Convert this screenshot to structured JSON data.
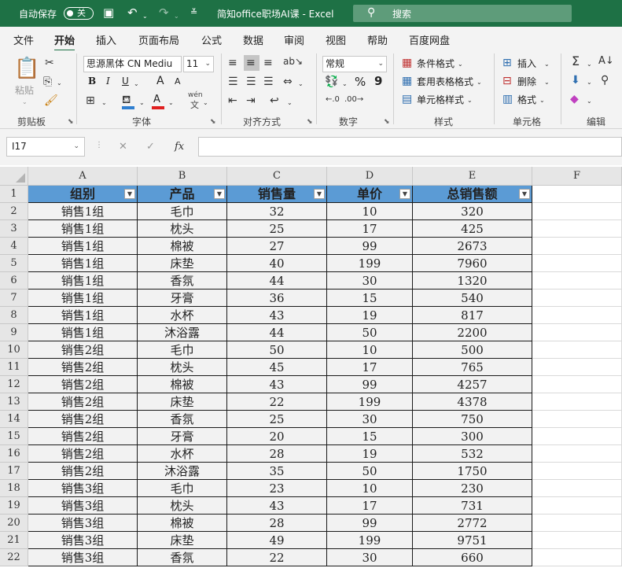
{
  "titlebar": {
    "autosave": "自动保存",
    "toggle": "关",
    "title": "简知office职场AI课  -  Excel",
    "search_placeholder": "搜索",
    "icons": [
      "save-icon",
      "undo-icon",
      "redo-icon",
      "customize-icon",
      "search-icon"
    ]
  },
  "menu": {
    "tabs": [
      "文件",
      "开始",
      "插入",
      "页面布局",
      "公式",
      "数据",
      "审阅",
      "视图",
      "帮助",
      "百度网盘"
    ],
    "active": "开始"
  },
  "ribbon": {
    "clipboard": {
      "paste": "粘贴",
      "group": "剪贴板"
    },
    "font": {
      "name": "思源黑体 CN Mediu",
      "size": "11",
      "bold": "B",
      "italic": "I",
      "underline": "U",
      "grow": "A",
      "shrink": "A",
      "wen": "wén",
      "wen_char": "文",
      "group": "字体"
    },
    "alignment": {
      "group": "对齐方式"
    },
    "number": {
      "format": "常规",
      "percent": "%",
      "comma": "9",
      "group": "数字"
    },
    "styles": {
      "conditional": "条件格式",
      "table": "套用表格格式",
      "cell": "单元格样式",
      "group": "样式"
    },
    "cells": {
      "insert": "插入",
      "delete": "删除",
      "format": "格式",
      "group": "单元格"
    },
    "editing": {
      "group": "编辑"
    }
  },
  "formulabar": {
    "namebox": "I17",
    "fx": "fx",
    "value": ""
  },
  "grid": {
    "columns": [
      "A",
      "B",
      "C",
      "D",
      "E",
      "F"
    ],
    "headers": [
      "组别",
      "产品",
      "销售量",
      "单价",
      "总销售额"
    ],
    "rows": [
      [
        "销售1组",
        "毛巾",
        "32",
        "10",
        "320"
      ],
      [
        "销售1组",
        "枕头",
        "25",
        "17",
        "425"
      ],
      [
        "销售1组",
        "棉被",
        "27",
        "99",
        "2673"
      ],
      [
        "销售1组",
        "床垫",
        "40",
        "199",
        "7960"
      ],
      [
        "销售1组",
        "香氛",
        "44",
        "30",
        "1320"
      ],
      [
        "销售1组",
        "牙膏",
        "36",
        "15",
        "540"
      ],
      [
        "销售1组",
        "水杯",
        "43",
        "19",
        "817"
      ],
      [
        "销售1组",
        "沐浴露",
        "44",
        "50",
        "2200"
      ],
      [
        "销售2组",
        "毛巾",
        "50",
        "10",
        "500"
      ],
      [
        "销售2组",
        "枕头",
        "45",
        "17",
        "765"
      ],
      [
        "销售2组",
        "棉被",
        "43",
        "99",
        "4257"
      ],
      [
        "销售2组",
        "床垫",
        "22",
        "199",
        "4378"
      ],
      [
        "销售2组",
        "香氛",
        "25",
        "30",
        "750"
      ],
      [
        "销售2组",
        "牙膏",
        "20",
        "15",
        "300"
      ],
      [
        "销售2组",
        "水杯",
        "28",
        "19",
        "532"
      ],
      [
        "销售2组",
        "沐浴露",
        "35",
        "50",
        "1750"
      ],
      [
        "销售3组",
        "毛巾",
        "23",
        "10",
        "230"
      ],
      [
        "销售3组",
        "枕头",
        "43",
        "17",
        "731"
      ],
      [
        "销售3组",
        "棉被",
        "28",
        "99",
        "2772"
      ],
      [
        "销售3组",
        "床垫",
        "49",
        "199",
        "9751"
      ],
      [
        "销售3组",
        "香氛",
        "22",
        "30",
        "660"
      ]
    ]
  }
}
